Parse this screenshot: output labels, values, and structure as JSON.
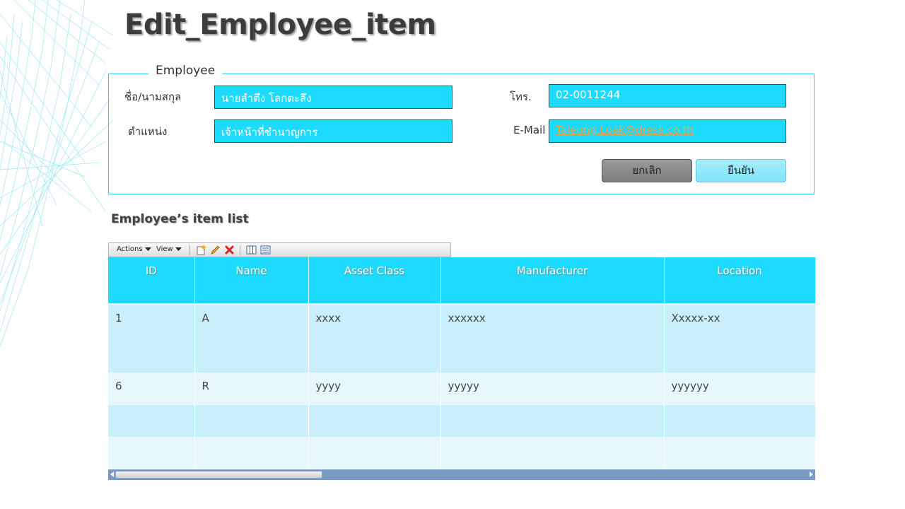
{
  "page_title": "Edit_Employee_item",
  "employee_form": {
    "legend": "Employee",
    "name_label": "ชื่อ/นามสกุล",
    "name_value": "นายลำตึง โลกตะลึง",
    "position_label": "ตำแหน่ง",
    "position_value": "เจ้าหน้าที่ชำนาญการ",
    "phone_label": "โทร.",
    "phone_value": "02-0011244",
    "email_label": "E-Mail",
    "email_value": "Taleung.Loak@dress.co.th",
    "cancel_label": "ยกเลิก",
    "confirm_label": "ยืนยัน"
  },
  "items_section": {
    "title": "Employee’s item list",
    "toolbar": {
      "actions_label": "Actions",
      "view_label": "View",
      "icons": [
        "new-item-icon",
        "edit-pencil-icon",
        "delete-x-icon",
        "columns-icon",
        "details-icon"
      ]
    },
    "columns": [
      "ID",
      "Name",
      "Asset Class",
      "Manufacturer",
      "Location"
    ],
    "rows": [
      [
        "1",
        "A",
        "xxxx",
        "xxxxxx",
        "Xxxxx-xx"
      ],
      [
        "6",
        "R",
        "yyyy",
        "yyyyy",
        "yyyyyy"
      ],
      [
        "",
        "",
        "",
        "",
        ""
      ],
      [
        "",
        "",
        "",
        "",
        ""
      ]
    ]
  },
  "colors": {
    "accent_cyan": "#1cdbfd",
    "fieldset_border": "#2bcfe8",
    "row_dark": "#c9effa",
    "row_light": "#e6f8fc",
    "scrollbar": "#7a9ac6"
  }
}
